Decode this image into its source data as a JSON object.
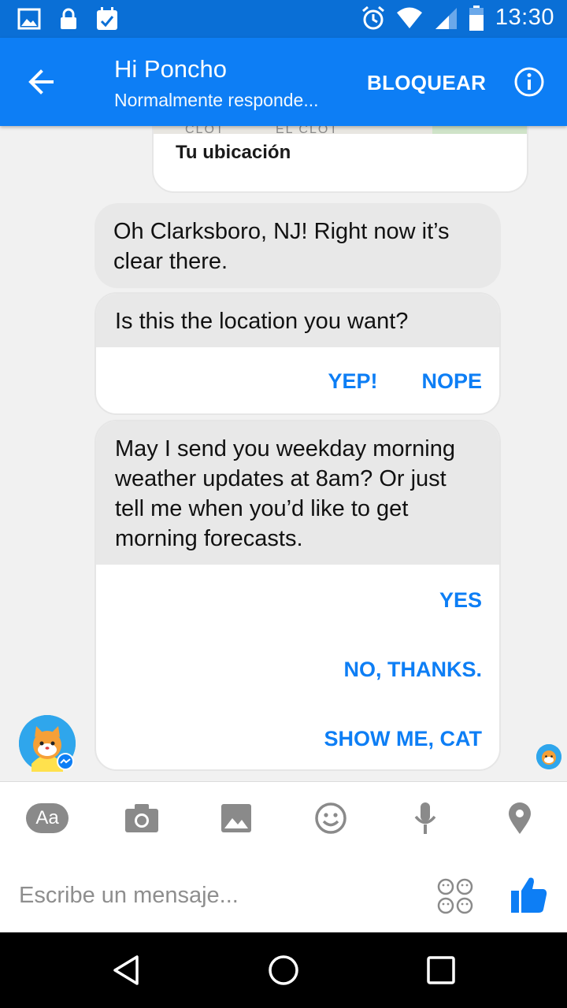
{
  "status_bar": {
    "time": "13:30"
  },
  "header": {
    "title": "Hi Poncho",
    "subtitle": "Normalmente responde...",
    "block_label": "BLOQUEAR"
  },
  "messages": {
    "location_card": {
      "label": "Tu ubicación",
      "map_text_left": "CLOT",
      "map_text_right": "EL CLOT"
    },
    "bubble1": "Oh Clarksboro, NJ! Right now it’s clear there.",
    "card2": {
      "question": "Is this the location you want?",
      "buttons": [
        "YEP!",
        "NOPE"
      ]
    },
    "card3": {
      "question": "May I send you weekday morning weather updates at 8am? Or just tell me when you’d like to get morning forecasts.",
      "options": [
        "YES",
        "NO, THANKS.",
        "SHOW ME, CAT"
      ]
    }
  },
  "composer": {
    "placeholder": "Escribe un mensaje...",
    "text_tool_label": "Aa"
  },
  "colors": {
    "primary": "#0d7ef5",
    "status_bar": "#0a6fd6",
    "bubble": "#e8e8e8",
    "icon_gray": "#8a8a8a"
  }
}
